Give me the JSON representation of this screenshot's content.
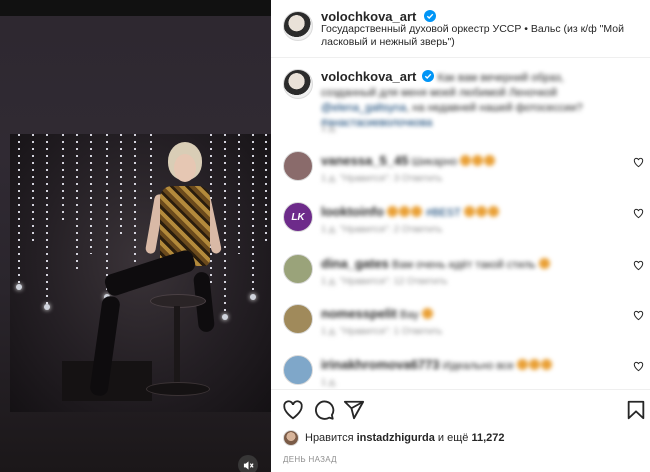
{
  "post": {
    "author": "volochkova_art",
    "audio": "Государственный духовой оркестр УССР • Вальс (из к/ф \"Мой ласковый и нежный зверь\")"
  },
  "caption": {
    "username": "volochkova_art",
    "text": "Как вам вечерний образ, созданный для меня моей любимой Леночкой",
    "mention": "@elena_galtsyna",
    "text2": ", на недавней нашей фотосессии?",
    "hashtag": "#анастасиеволочкова",
    "time": "1 д."
  },
  "comments": [
    {
      "username": "vanessa_5_45",
      "text": "Шикарно",
      "meta": "1 д.   \"Нравится\": 3   Ответить",
      "avatar_color": "#8a6b6b"
    },
    {
      "username": "looktoinfo",
      "text": "#BEST",
      "meta": "1 д.   \"Нравится\": 2   Ответить",
      "avatar_color": "#6d2b8a",
      "avatar_label": "LK"
    },
    {
      "username": "dina_gates",
      "text": "Вам очень идёт такой стиль",
      "meta": "1 д.   \"Нравится\": 12   Ответить",
      "avatar_color": "#9aa37a"
    },
    {
      "username": "nomesspelit",
      "text": "Вау",
      "meta": "1 д.   \"Нравится\": 1   Ответить",
      "avatar_color": "#a08a5b"
    },
    {
      "username": "irinakhromova6773",
      "text": "Идеально все",
      "meta": "1 д.",
      "avatar_color": "#7fa7c9"
    }
  ],
  "likes": {
    "prefix": "Нравится",
    "user": "instadzhigurda",
    "middle": "и ещё",
    "count": "11,272"
  },
  "date": "ДЕНЬ НАЗАД",
  "colors": {
    "verified": "#0095f6",
    "link": "#00376b",
    "muted": "#8e8e8e"
  },
  "icons": [
    "verified-icon",
    "heart-icon",
    "comment-icon",
    "share-icon",
    "bookmark-icon",
    "mute-icon"
  ]
}
